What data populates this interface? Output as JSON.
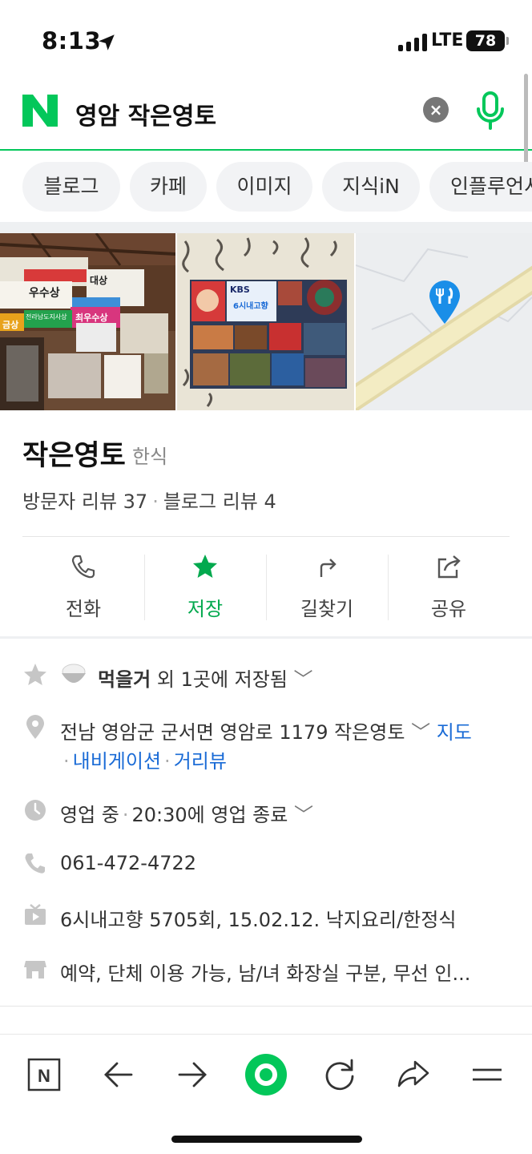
{
  "status_bar": {
    "time": "8:13",
    "network": "LTE",
    "battery": "78"
  },
  "search": {
    "logo": "N",
    "query": "영암 작은영토",
    "clear_icon": "close-circle-icon",
    "mic_icon": "microphone-icon"
  },
  "tabs": [
    {
      "label": "블로그"
    },
    {
      "label": "카페"
    },
    {
      "label": "이미지"
    },
    {
      "label": "지식iN"
    },
    {
      "label": "인플루언서"
    }
  ],
  "place": {
    "name": "작은영토",
    "category": "한식",
    "visitor_reviews": "방문자 리뷰 37",
    "blog_reviews": "블로그 리뷰 4",
    "separator": "·"
  },
  "photos": {
    "award_texts": [
      "대상",
      "우수상",
      "최우수상",
      "금상",
      "전라남도지사상"
    ],
    "tv_texts": [
      "KBS",
      "6시내고향"
    ]
  },
  "actions": [
    {
      "label": "전화",
      "icon": "phone-icon"
    },
    {
      "label": "저장",
      "icon": "star-icon"
    },
    {
      "label": "길찾기",
      "icon": "directions-icon"
    },
    {
      "label": "공유",
      "icon": "share-icon"
    }
  ],
  "info": {
    "saved": {
      "list_name": "먹을거",
      "suffix": "외 1곳에 저장됨",
      "icon": "star-icon"
    },
    "address": {
      "text": "전남 영암군 군서면 영암로 1179 작은영토",
      "map_link": "지도",
      "nav_link": "내비게이션",
      "street_link": "거리뷰",
      "icon": "location-pin-icon"
    },
    "hours": {
      "status": "영업 중",
      "detail": "20:30에 영업 종료",
      "icon": "clock-icon"
    },
    "phone": {
      "number": "061-472-4722",
      "icon": "phone-icon"
    },
    "tv": {
      "text": "6시내고향 5705회, 15.02.12. 낙지요리/한정식",
      "icon": "tv-icon"
    },
    "facilities": {
      "text": "예약, 단체 이용 가능, 남/녀 화장실 구분, 무선 인...",
      "icon": "store-icon"
    }
  },
  "toolbar": [
    {
      "icon": "naver-home-icon",
      "label": "N"
    },
    {
      "icon": "back-arrow-icon"
    },
    {
      "icon": "forward-arrow-icon"
    },
    {
      "icon": "green-dot-icon"
    },
    {
      "icon": "reload-icon"
    },
    {
      "icon": "share-arrow-icon"
    },
    {
      "icon": "menu-icon"
    }
  ],
  "colors": {
    "brand_green": "#03c75a",
    "link_blue": "#1a6bd6",
    "save_green": "#03a94e"
  }
}
